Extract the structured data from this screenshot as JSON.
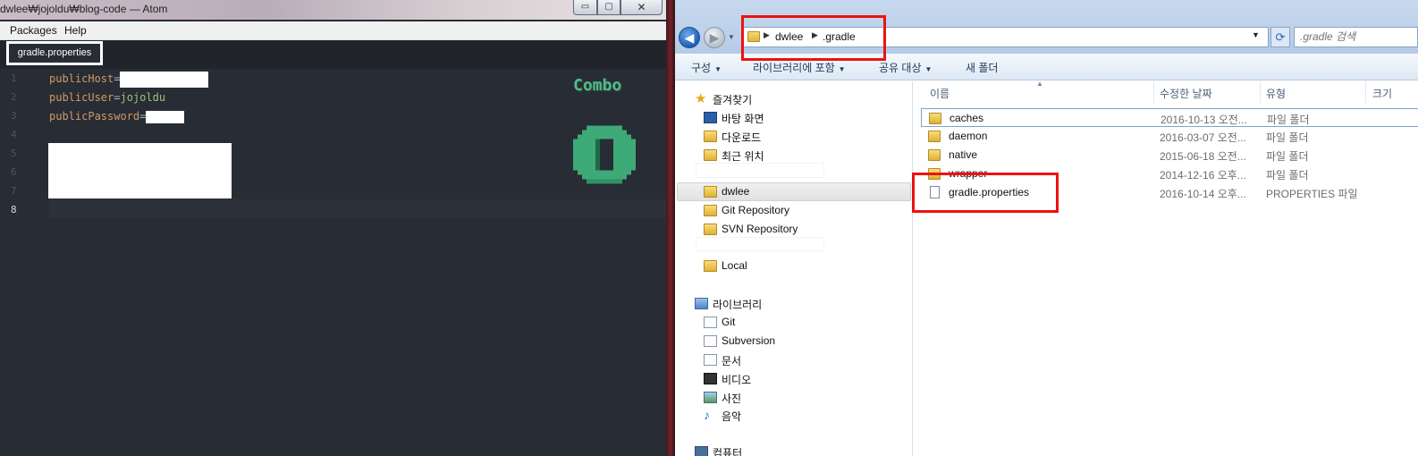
{
  "atom": {
    "title": "dwlee₩jojoldu₩blog-code — Atom",
    "window_buttons": {
      "minimize": "▭",
      "maximize": "▢",
      "close": "✕"
    },
    "menu": [
      "Packages",
      "Help"
    ],
    "tab": "gradle.properties",
    "gutter": [
      "1",
      "2",
      "3",
      "4",
      "5",
      "6",
      "7",
      "8"
    ],
    "code": {
      "line1_key": "publicHost",
      "line2_key": "publicUser",
      "line2_value": "jojoldu",
      "line3_key": "publicPassword",
      "equals": "="
    },
    "combo": {
      "label": "Combo",
      "count": 0
    }
  },
  "explorer": {
    "breadcrumb": [
      "dwlee",
      ".gradle"
    ],
    "search_placeholder": ".gradle 검색",
    "toolbar": [
      "구성",
      "라이브러리에 포함",
      "공유 대상",
      "새 폴더"
    ],
    "nav": {
      "favorites": "즐겨찾기",
      "favorite_items": [
        "바탕 화면",
        "다운로드",
        "최근 위치"
      ],
      "user_folder": "dwlee",
      "user_items": [
        "Git Repository",
        "SVN Repository"
      ],
      "local": "Local",
      "libraries": "라이브러리",
      "library_items": [
        "Git",
        "Subversion",
        "문서",
        "비디오",
        "사진",
        "음악"
      ],
      "computer": "컴퓨터"
    },
    "columns": [
      "이름",
      "수정한 날짜",
      "유형",
      "크기"
    ],
    "files": [
      {
        "name": "caches",
        "date": "2016-10-13 오전...",
        "type": "파일 폴더",
        "kind": "folder"
      },
      {
        "name": "daemon",
        "date": "2016-03-07 오전...",
        "type": "파일 폴더",
        "kind": "folder"
      },
      {
        "name": "native",
        "date": "2015-06-18 오전...",
        "type": "파일 폴더",
        "kind": "folder"
      },
      {
        "name": "wrapper",
        "date": "2014-12-16 오후...",
        "type": "파일 폴더",
        "kind": "folder"
      },
      {
        "name": "gradle.properties",
        "date": "2016-10-14 오후...",
        "type": "PROPERTIES 파일",
        "kind": "file"
      }
    ]
  },
  "colors": {
    "editor_bg": "#282c34",
    "key": "#d19a66",
    "value": "#98c379",
    "combo": "#55b88a",
    "highlight_box": "#ee1111"
  }
}
